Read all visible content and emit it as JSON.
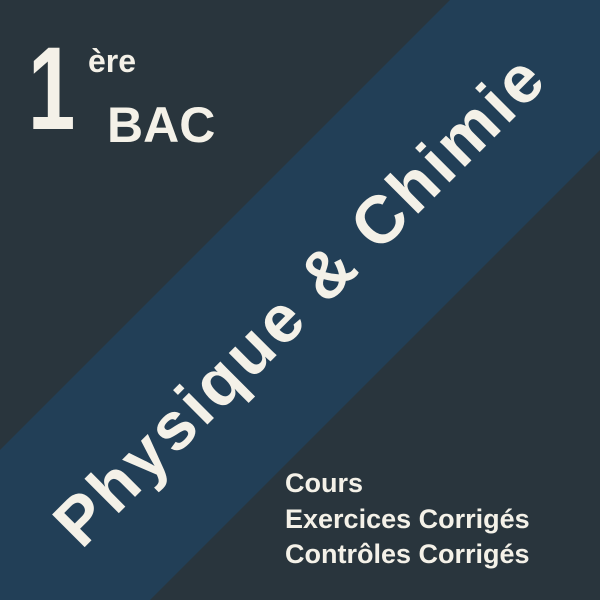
{
  "cover": {
    "level": {
      "number": "1",
      "superscript": "ère",
      "label": "BAC"
    },
    "subject": "Physique & Chimie",
    "contents": [
      "Cours",
      "Exercices Corrigés",
      "Contrôles Corrigés"
    ],
    "colors": {
      "background": "#29353d",
      "diagonal_band": "#223f57",
      "text": "#f4f1e8"
    }
  }
}
